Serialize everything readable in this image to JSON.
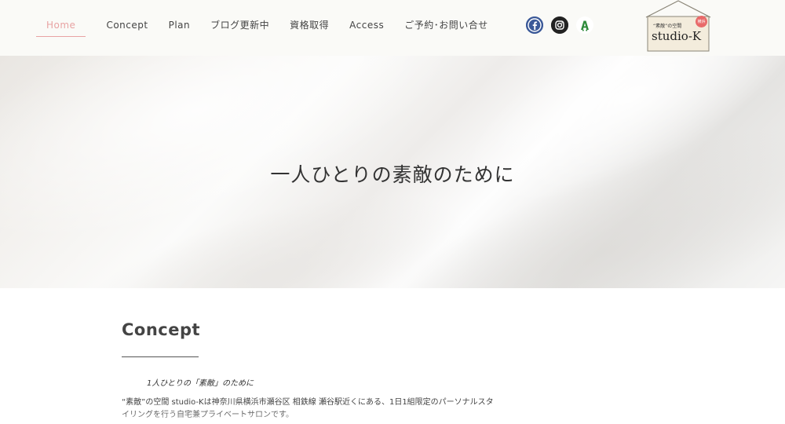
{
  "nav": {
    "items": [
      {
        "label": "Home",
        "active": true
      },
      {
        "label": "Concept",
        "active": false
      },
      {
        "label": "Plan",
        "active": false
      },
      {
        "label": "ブログ更新中",
        "active": false
      },
      {
        "label": "資格取得",
        "active": false
      },
      {
        "label": "Access",
        "active": false
      },
      {
        "label": "ご予約･お問い合せ",
        "active": false
      }
    ],
    "active_color": "#e8a3a3"
  },
  "social": {
    "items": [
      {
        "icon": "facebook-icon",
        "glyph": "f",
        "color": "#3b5998"
      },
      {
        "icon": "instagram-icon",
        "glyph": "◎",
        "color": "#222222"
      },
      {
        "icon": "ameblo-icon",
        "glyph": "A",
        "color": "#2e8b3a"
      }
    ]
  },
  "logo": {
    "tagline": "“素敵”の空間",
    "name": "studio-K",
    "badge": "横浜",
    "badge_color": "#e86a6a"
  },
  "hero": {
    "title": "一人ひとりの素敵のために"
  },
  "concept": {
    "title": "Concept",
    "subtitle": "1人ひとりの「素敵」のために",
    "body_line1": "“素敵”の空間 studio-Kは神奈川県横浜市瀬谷区 相鉄線 瀬谷駅近くにある、1日1組限定のパーソナルスタ",
    "body_line2": "イリングを行う自宅兼プライベートサロンです。"
  }
}
